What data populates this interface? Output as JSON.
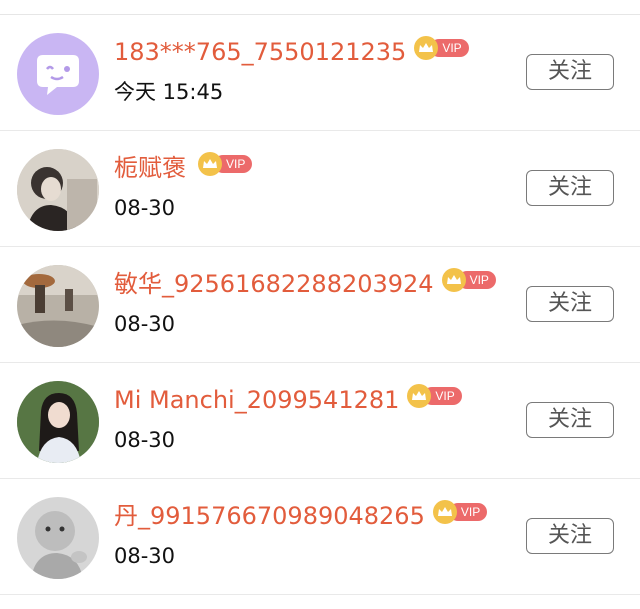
{
  "followers": [
    {
      "name": "183***765_7550121235",
      "time": "今天 15:45",
      "vip": "VIP",
      "follow_label": "关注",
      "avatar": "chat-bubble-avatar"
    },
    {
      "name": "栀赋褒",
      "time": "08-30",
      "vip": "VIP",
      "follow_label": "关注",
      "avatar": "woman-photo-avatar"
    },
    {
      "name": "敏华_92561682288203924",
      "time": "08-30",
      "vip": "VIP",
      "follow_label": "关注",
      "avatar": "rain-street-avatar"
    },
    {
      "name": "Mi Manchi_2099541281",
      "time": "08-30",
      "vip": "VIP",
      "follow_label": "关注",
      "avatar": "girl-photo-avatar"
    },
    {
      "name": "丹_991576670989048265",
      "time": "08-30",
      "vip": "VIP",
      "follow_label": "关注",
      "avatar": "baby-photo-avatar"
    }
  ],
  "colors": {
    "name": "#e25c3c",
    "vip_tag": "#ec6a6a",
    "crown": "#f3c24a",
    "avatar_purple": "#c9b6f3"
  }
}
